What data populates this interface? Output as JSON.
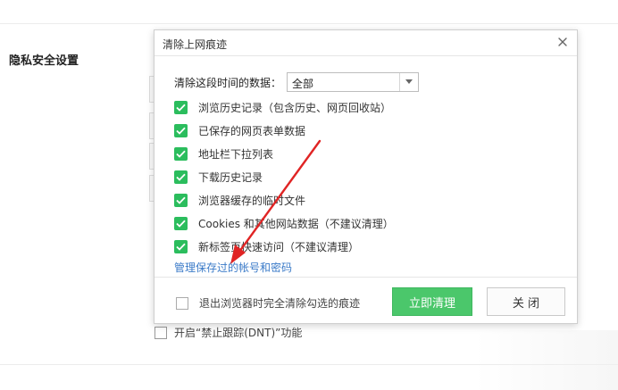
{
  "background": {
    "section_title": "隐私安全设置",
    "dnt_label": "开启“禁止跟踪(DNT)”功能"
  },
  "dialog": {
    "title": "清除上网痕迹",
    "time_range": {
      "label": "清除这段时间的数据：",
      "selected": "全部"
    },
    "options": [
      {
        "label": "浏览历史记录（包含历史、网页回收站）",
        "checked": true
      },
      {
        "label": "已保存的网页表单数据",
        "checked": true
      },
      {
        "label": "地址栏下拉列表",
        "checked": true
      },
      {
        "label": "下载历史记录",
        "checked": true
      },
      {
        "label": "浏览器缓存的临时文件",
        "checked": true
      },
      {
        "label": "Cookies 和其他网站数据（不建议清理）",
        "checked": true
      },
      {
        "label": "新标签页快速访问（不建议清理）",
        "checked": true
      }
    ],
    "manage_link": "管理保存过的帐号和密码",
    "exit_option": {
      "label": "退出浏览器时完全清除勾选的痕迹",
      "checked": false
    },
    "clear_button": "立即清理",
    "close_button": "关 闭"
  },
  "colors": {
    "checkbox_checked": "#2bbd5d",
    "primary_button": "#4bc76b",
    "link": "#3a7ac8",
    "annotation_arrow": "#e02424"
  },
  "icons": {
    "close": "close-icon",
    "dropdown": "chevron-down-icon",
    "check": "check-icon",
    "annotation": "red-arrow-icon"
  }
}
